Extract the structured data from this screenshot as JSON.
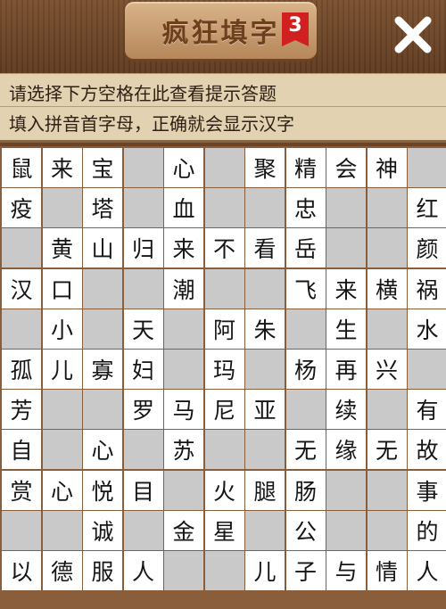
{
  "header": {
    "title": "疯狂填字",
    "level": "3"
  },
  "hints": {
    "line1": "请选择下方空格在此查看提示答题",
    "line2": "填入拼音首字母，正确就会显示汉字"
  },
  "grid": {
    "rows": [
      [
        "鼠",
        "来",
        "宝",
        "",
        "心",
        "",
        "聚",
        "精",
        "会",
        "神",
        ""
      ],
      [
        "疫",
        "",
        "塔",
        "",
        "血",
        "",
        "",
        "忠",
        "",
        "",
        "红"
      ],
      [
        "",
        "黄",
        "山",
        "归",
        "来",
        "不",
        "看",
        "岳",
        "",
        "",
        "颜"
      ],
      [
        "汉",
        "口",
        "",
        "",
        "潮",
        "",
        "",
        "飞",
        "来",
        "横",
        "祸"
      ],
      [
        "",
        "小",
        "",
        "天",
        "",
        "阿",
        "朱",
        "",
        "生",
        "",
        "水"
      ],
      [
        "孤",
        "儿",
        "寡",
        "妇",
        "",
        "玛",
        "",
        "杨",
        "再",
        "兴",
        ""
      ],
      [
        "芳",
        "",
        "",
        "罗",
        "马",
        "尼",
        "亚",
        "",
        "续",
        "",
        "有"
      ],
      [
        "自",
        "",
        "心",
        "",
        "苏",
        "",
        "",
        "无",
        "缘",
        "无",
        "故"
      ],
      [
        "赏",
        "心",
        "悦",
        "目",
        "",
        "火",
        "腿",
        "肠",
        "",
        "",
        "事"
      ],
      [
        "",
        "",
        "诚",
        "",
        "金",
        "星",
        "",
        "公",
        "",
        "",
        "的"
      ],
      [
        "以",
        "德",
        "服",
        "人",
        "",
        "",
        "儿",
        "子",
        "与",
        "情",
        "人"
      ]
    ],
    "active": [
      [
        1,
        1,
        1,
        0,
        1,
        0,
        1,
        1,
        1,
        1,
        0
      ],
      [
        1,
        0,
        1,
        0,
        1,
        0,
        0,
        1,
        0,
        0,
        1
      ],
      [
        0,
        1,
        1,
        1,
        1,
        1,
        1,
        1,
        0,
        0,
        1
      ],
      [
        1,
        1,
        0,
        0,
        1,
        0,
        0,
        1,
        1,
        1,
        1
      ],
      [
        0,
        1,
        0,
        1,
        0,
        1,
        1,
        0,
        1,
        0,
        1
      ],
      [
        1,
        1,
        1,
        1,
        0,
        1,
        0,
        1,
        1,
        1,
        0
      ],
      [
        1,
        0,
        0,
        1,
        1,
        1,
        1,
        0,
        1,
        0,
        1
      ],
      [
        1,
        0,
        1,
        0,
        1,
        0,
        0,
        1,
        1,
        1,
        1
      ],
      [
        1,
        1,
        1,
        1,
        0,
        1,
        1,
        1,
        0,
        0,
        1
      ],
      [
        0,
        0,
        1,
        0,
        1,
        1,
        0,
        1,
        0,
        0,
        1
      ],
      [
        1,
        1,
        1,
        1,
        0,
        0,
        1,
        1,
        1,
        1,
        1
      ]
    ]
  },
  "colors": {
    "wood": "#6b4428",
    "banner": "#e3d2b1",
    "cell_active": "#ffffff",
    "cell_blocked": "#c9c9c9",
    "badge": "#d12020"
  }
}
